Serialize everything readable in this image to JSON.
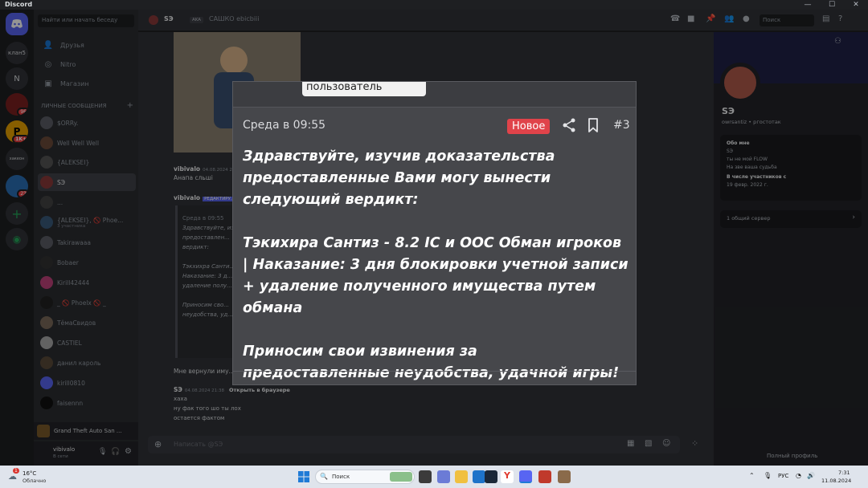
{
  "window": {
    "title": "Discord",
    "min": "—",
    "max": "☐",
    "close": "✕"
  },
  "servers": [
    {
      "label": "",
      "type": "home"
    },
    {
      "label": "клан5"
    },
    {
      "label": "N"
    },
    {
      "label": "",
      "badge": "96"
    },
    {
      "label": "P",
      "badge": "1K+"
    },
    {
      "label": "хакеон"
    },
    {
      "label": "",
      "badge": "23"
    },
    {
      "label": "+"
    },
    {
      "label": "◉"
    }
  ],
  "sidebar": {
    "search_placeholder": "Найти или начать беседу",
    "nav": [
      {
        "label": "Друзья",
        "icon": "friends-icon"
      },
      {
        "label": "Nitro",
        "icon": "nitro-icon"
      },
      {
        "label": "Магазин",
        "icon": "shop-icon"
      }
    ],
    "dm_header": "ЛИЧНЫЕ СООБЩЕНИЯ",
    "dms": [
      {
        "name": "$ORRy."
      },
      {
        "name": "Well Well Well"
      },
      {
        "name": "{ALEKSEI}"
      },
      {
        "name": "SЭ",
        "selected": true
      },
      {
        "name": "..."
      },
      {
        "name": "{ALEKSEI}, 🚫 Phoe...",
        "sub": "3 участника"
      },
      {
        "name": "Takirawaaa"
      },
      {
        "name": "Bobaer"
      },
      {
        "name": "Kirill42444"
      },
      {
        "name": "_ 🚫 Phoelx 🚫 _"
      },
      {
        "name": "ТёмаСвидов"
      },
      {
        "name": "CASTIEL"
      },
      {
        "name": "данил кароль"
      },
      {
        "name": "kirill0810"
      },
      {
        "name": "faisennn"
      }
    ],
    "game": "Grand Theft Auto San ...",
    "user": {
      "name": "vibivalo",
      "status": "В сети"
    }
  },
  "topbar": {
    "channel": "SЭ",
    "tag": "AKA",
    "status": "САШКО ebicbiii",
    "search_placeholder": "Поиск"
  },
  "messages": [
    {
      "user": "vibivalo",
      "time": "04.08.2024 20:14",
      "text": "Анапа сльші"
    },
    {
      "user": "vibivalo",
      "tag": "РЕДАКТИРУ...",
      "quote": [
        "Среда в 09:55",
        "Здравствуйте, изучив доказательства",
        "предоставлен...",
        "вердикт:",
        "Тэкхихра Санти...",
        "Наказание: 3 д...",
        "удаление полу...",
        "Приносим сво...",
        "неудобства, уд..."
      ]
    },
    {
      "text": "Мне вернули иму..."
    },
    {
      "user": "SЭ",
      "time": "04.08.2024 21:38",
      "action": "Открыть в браузере",
      "lines": [
        "хаха",
        "ну фак  того шо ты лох",
        "остается фактом"
      ]
    }
  ],
  "composer": {
    "placeholder": "Написать @SЭ"
  },
  "profile": {
    "name": "SЭ",
    "handle": "owrsantiz • ргостотак",
    "about_label": "Обо мне",
    "about": [
      "SЭ",
      "ты не мой FLOW",
      "На зве ваша судьба"
    ],
    "member_since_label": "В числе участников с",
    "member_since": "19 февр. 2022 г.",
    "mutual": "1 общий сервер",
    "full_profile": "Полный профиль"
  },
  "overlay": {
    "username": "пользователь",
    "date": "Среда в 09:55",
    "badge": "Новое",
    "number": "#3",
    "paragraphs": [
      "Здравствуйте, изучив доказательства предоставленные Вами могу вынести следующий вердикт:",
      "Тэкихира Сантиз - 8.2 IC и OOC Обман игроков | Наказание: 3 дня блокировки учетной записи + удаление полученного имущества путем обмана",
      "Приносим свои извинения за предоставленные неудобства, удачной игры!"
    ]
  },
  "taskbar": {
    "weather_temp": "16°C",
    "weather_desc": "Облачно",
    "weather_badge": "1",
    "search": "Поиск",
    "lang": "РУС",
    "time": "7:31",
    "date": "11.08.2024"
  },
  "colors": {
    "accent": "#5865f2",
    "badge_new": "#e0434a",
    "online": "#23a559"
  }
}
